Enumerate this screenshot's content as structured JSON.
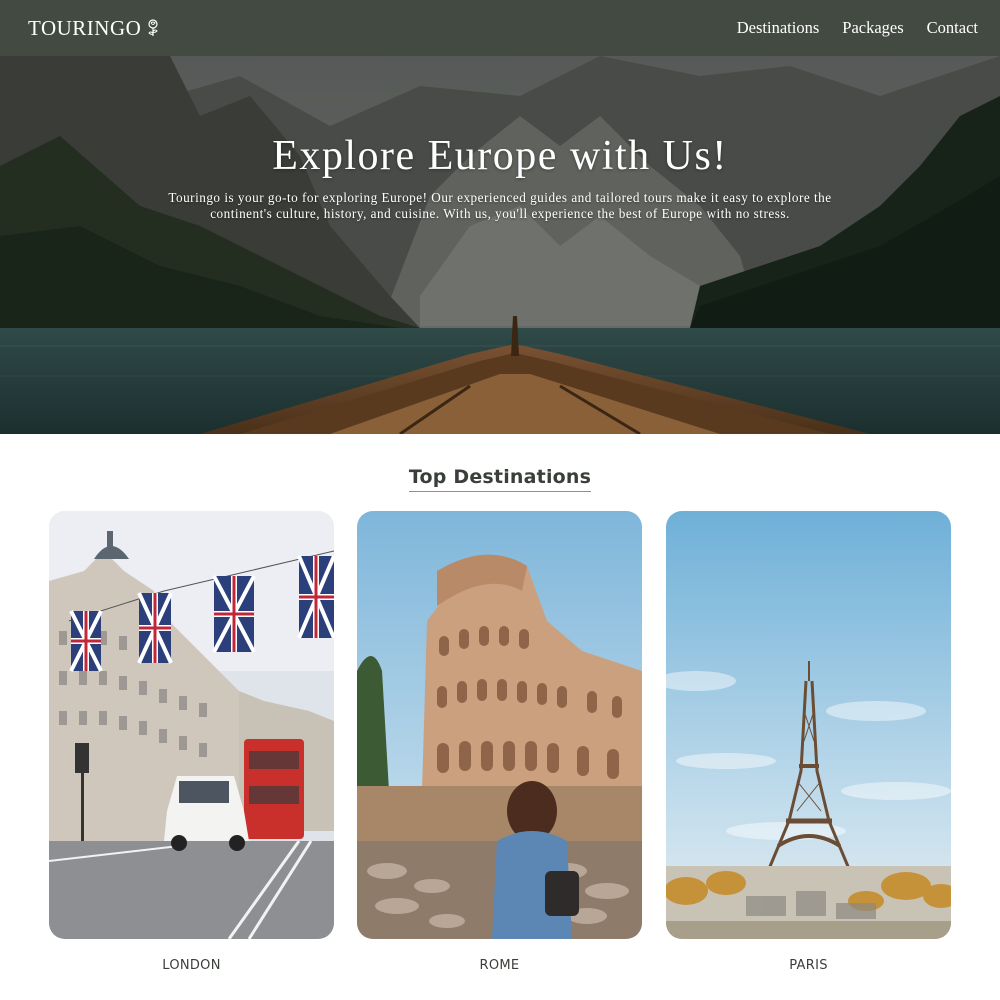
{
  "navbar": {
    "brand": "TOURINGO",
    "brand_icon": "rose-icon",
    "links": [
      {
        "label": "Destinations"
      },
      {
        "label": "Packages"
      },
      {
        "label": "Contact"
      }
    ],
    "background": "#434a41"
  },
  "hero": {
    "title": "Explore Europe with Us!",
    "description": "Touringo is your go-to for exploring Europe! Our experienced guides and tailored tours make it easy to explore the continent's culture, history, and cuisine. With us, you'll experience the best of Europe with no stress."
  },
  "destinations": {
    "title": "Top Destinations",
    "cards": [
      {
        "label": "LONDON"
      },
      {
        "label": "ROME"
      },
      {
        "label": "PARIS"
      }
    ]
  }
}
